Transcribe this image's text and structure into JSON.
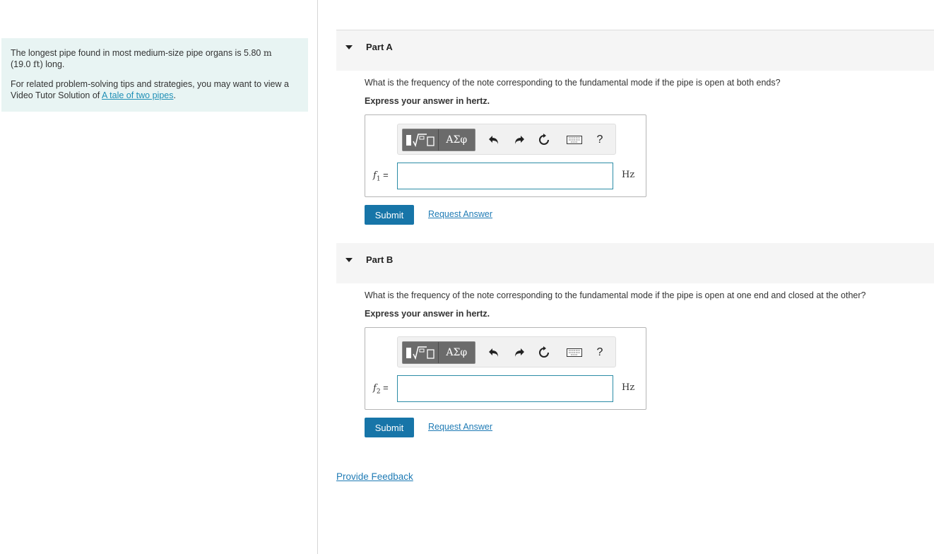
{
  "intro": {
    "problem_text_1": "The longest pipe found in most medium-size pipe organs is 5.80 ",
    "problem_unit_1": "m",
    "problem_text_2": "(19.0 ",
    "problem_unit_2": "ft",
    "problem_text_3": ") long.",
    "tips_text": "For related problem-solving tips and strategies, you may want to view a Video Tutor Solution of ",
    "tips_link": "A tale of two pipes",
    "tips_end": "."
  },
  "parts": [
    {
      "title": "Part A",
      "question": "What is the frequency of the note corresponding to the fundamental mode if the pipe is open at both ends?",
      "express": "Express your answer in hertz.",
      "var_letter": "f",
      "var_sub": "1",
      "var_eq": " =",
      "unit": "Hz",
      "value": "",
      "submit_label": "Submit",
      "request_label": "Request Answer"
    },
    {
      "title": "Part B",
      "question": "What is the frequency of the note corresponding to the fundamental mode if the pipe is open at one end and closed at the other?",
      "express": "Express your answer in hertz.",
      "var_letter": "f",
      "var_sub": "2",
      "var_eq": " =",
      "unit": "Hz",
      "value": "",
      "submit_label": "Submit",
      "request_label": "Request Answer"
    }
  ],
  "toolbar": {
    "greek_label": "ΑΣφ",
    "help_label": "?",
    "icons": [
      "templates-icon",
      "undo-icon",
      "redo-icon",
      "reset-icon",
      "keyboard-icon",
      "help-icon"
    ]
  },
  "feedback_label": "Provide Feedback",
  "colors": {
    "intro_bg": "#e8f4f3",
    "submit_bg": "#1775a8",
    "link": "#1f7bb5",
    "input_border": "#2b8ca6"
  }
}
